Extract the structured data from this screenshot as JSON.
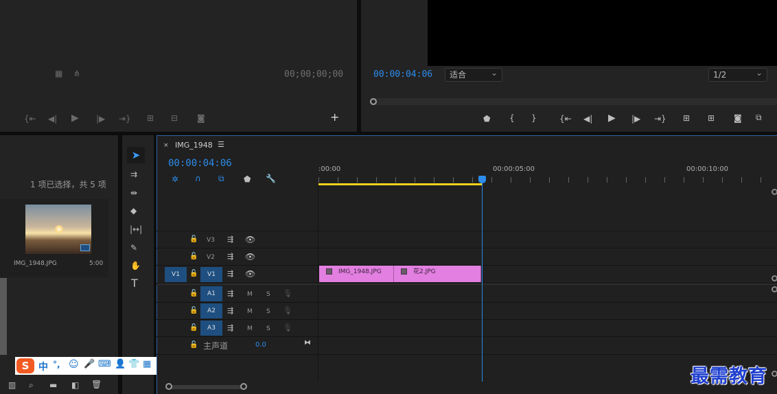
{
  "source_monitor": {
    "timecode": "00;00;00;00"
  },
  "program_monitor": {
    "timecode": "00:00:04:06",
    "fit_select": "适合",
    "res_select": "1/2"
  },
  "project_panel": {
    "selection_status": "1 项已选择，共 5 项",
    "item": {
      "name": "IMG_1948.JPG",
      "duration": "5:00"
    }
  },
  "timeline": {
    "sequence_name": "IMG_1948",
    "timecode": "00:00:04:06",
    "ruler_labels": [
      ":00:00",
      "00:00:05:00",
      "00:00:10:00"
    ],
    "tracks": {
      "v3": "V3",
      "v2": "V2",
      "v1": "V1",
      "v1_source": "V1",
      "a1": "A1",
      "a2": "A2",
      "a3": "A3",
      "mute": "M",
      "solo": "S",
      "master_label": "主声道",
      "master_value": "0.0"
    },
    "clips": [
      "IMG_1948.JPG",
      "花2.JPG"
    ]
  },
  "ime_toolbar": {
    "logo": "S",
    "lang": "中",
    "punct": "°,"
  },
  "watermark": "最需教育",
  "colors": {
    "accent": "#2d8ceb",
    "clip": "#e27fe0",
    "ruler_in_out": "#f2d21c",
    "track_target": "#1e4f80",
    "panel": "#232323",
    "ime_logo": "#f15a22"
  }
}
